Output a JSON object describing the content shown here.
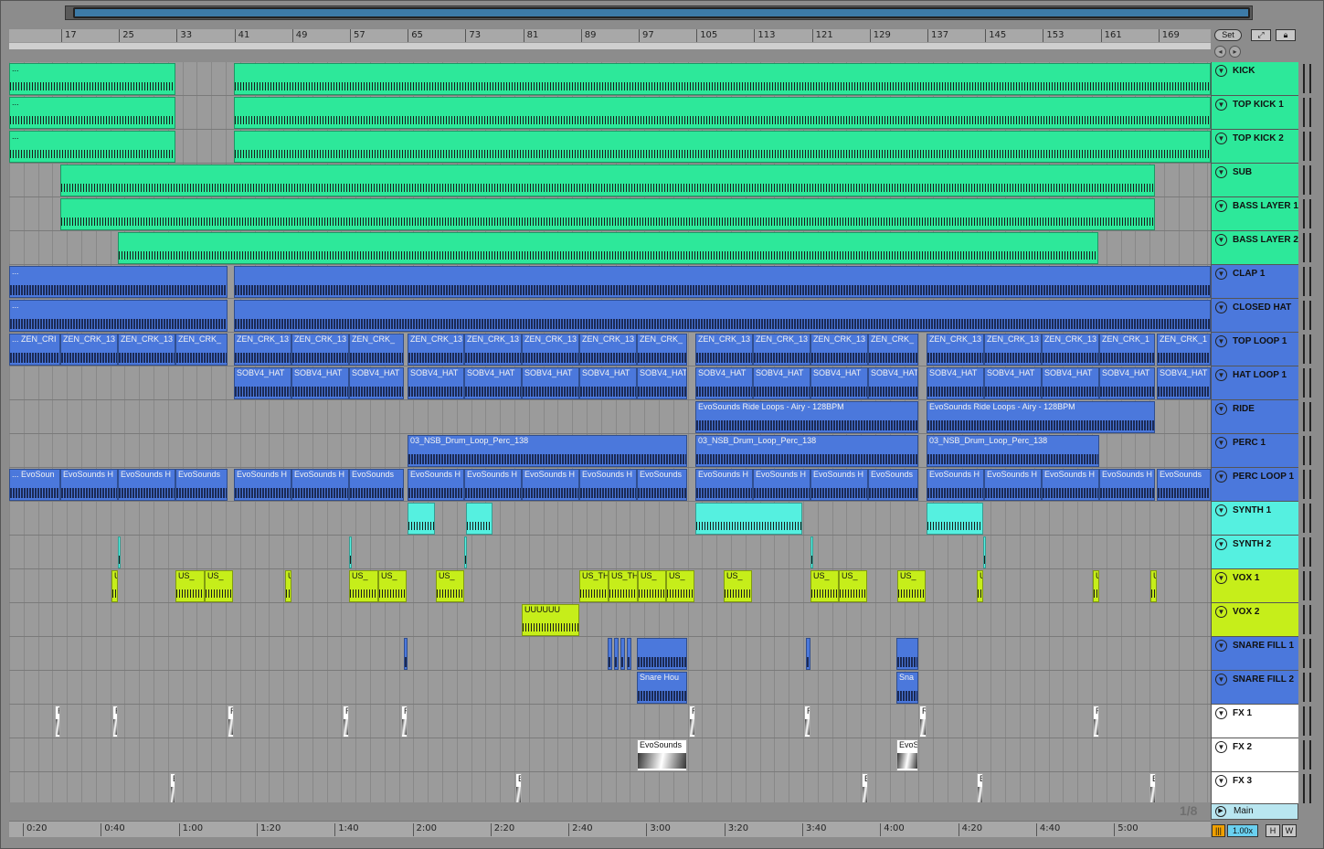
{
  "bars": [
    "17",
    "25",
    "33",
    "41",
    "49",
    "57",
    "65",
    "73",
    "81",
    "89",
    "97",
    "105",
    "113",
    "121",
    "129",
    "137",
    "145",
    "153",
    "161",
    "169"
  ],
  "times": [
    "0:20",
    "0:40",
    "1:00",
    "1:20",
    "1:40",
    "2:00",
    "2:20",
    "2:40",
    "3:00",
    "3:20",
    "3:40",
    "4:00",
    "4:20",
    "4:40",
    "5:00"
  ],
  "grid_quant": "1/8",
  "controls": {
    "set_label": "Set",
    "follow_icon": "follow-icon",
    "lock_icon": "lock-icon",
    "zoom": "1.00x",
    "h_label": "H",
    "w_label": "W"
  },
  "main_track": {
    "label": "Main"
  },
  "colors": {
    "green": "#2de89a",
    "blue": "#4b78dc",
    "cyan": "#55f0e0",
    "lime": "#c6ee1a",
    "white": "#ffffff"
  },
  "tracks": [
    {
      "name": "KICK",
      "color": "#2de89a"
    },
    {
      "name": "TOP KICK 1",
      "color": "#2de89a"
    },
    {
      "name": "TOP KICK 2",
      "color": "#2de89a"
    },
    {
      "name": "SUB",
      "color": "#2de89a"
    },
    {
      "name": "BASS LAYER 1",
      "color": "#2de89a"
    },
    {
      "name": "BASS LAYER 2",
      "color": "#2de89a"
    },
    {
      "name": "CLAP 1",
      "color": "#4b78dc"
    },
    {
      "name": "CLOSED HAT",
      "color": "#4b78dc"
    },
    {
      "name": "TOP LOOP 1",
      "color": "#4b78dc"
    },
    {
      "name": "HAT LOOP 1",
      "color": "#4b78dc"
    },
    {
      "name": "RIDE",
      "color": "#4b78dc"
    },
    {
      "name": "PERC 1",
      "color": "#4b78dc"
    },
    {
      "name": "PERC LOOP 1",
      "color": "#4b78dc"
    },
    {
      "name": "SYNTH 1",
      "color": "#55f0e0"
    },
    {
      "name": "SYNTH 2",
      "color": "#55f0e0"
    },
    {
      "name": "VOX 1",
      "color": "#c6ee1a"
    },
    {
      "name": "VOX 2",
      "color": "#c6ee1a"
    },
    {
      "name": "SNARE FILL 1",
      "color": "#4b78dc"
    },
    {
      "name": "SNARE FILL 2",
      "color": "#4b78dc"
    },
    {
      "name": "FX 1",
      "color": "#ffffff"
    },
    {
      "name": "FX 2",
      "color": "#ffffff"
    },
    {
      "name": "FX 3",
      "color": "#ffffff"
    }
  ],
  "clips": [
    {
      "track": 0,
      "start": 0,
      "end": 182,
      "label": "...",
      "color": "#2de89a"
    },
    {
      "track": 0,
      "start": 246,
      "end": 1315,
      "label": "",
      "color": "#2de89a"
    },
    {
      "track": 1,
      "start": 0,
      "end": 182,
      "label": "...",
      "color": "#2de89a"
    },
    {
      "track": 1,
      "start": 246,
      "end": 1315,
      "label": "",
      "color": "#2de89a"
    },
    {
      "track": 2,
      "start": 0,
      "end": 182,
      "label": "...",
      "color": "#2de89a"
    },
    {
      "track": 2,
      "start": 246,
      "end": 1315,
      "label": "",
      "color": "#2de89a"
    },
    {
      "track": 3,
      "start": 56,
      "end": 1254,
      "label": "",
      "color": "#2de89a"
    },
    {
      "track": 4,
      "start": 56,
      "end": 1254,
      "label": "",
      "color": "#2de89a"
    },
    {
      "track": 5,
      "start": 119,
      "end": 1192,
      "label": "",
      "color": "#2de89a"
    },
    {
      "track": 6,
      "start": 0,
      "end": 239,
      "label": "...",
      "color": "#4b78dc"
    },
    {
      "track": 6,
      "start": 246,
      "end": 1315,
      "label": "",
      "color": "#4b78dc"
    },
    {
      "track": 7,
      "start": 0,
      "end": 239,
      "label": "...",
      "color": "#4b78dc"
    },
    {
      "track": 7,
      "start": 246,
      "end": 1315,
      "label": "",
      "color": "#4b78dc"
    },
    {
      "track": 8,
      "start": 0,
      "end": 56,
      "label": "... ZEN_CRI",
      "color": "#4b78dc"
    },
    {
      "track": 8,
      "start": 56,
      "end": 119,
      "label": "ZEN_CRK_13",
      "color": "#4b78dc"
    },
    {
      "track": 8,
      "start": 119,
      "end": 182,
      "label": "ZEN_CRK_13",
      "color": "#4b78dc"
    },
    {
      "track": 8,
      "start": 182,
      "end": 239,
      "label": "ZEN_CRK_",
      "color": "#4b78dc"
    },
    {
      "track": 8,
      "start": 246,
      "end": 309,
      "label": "ZEN_CRK_13",
      "color": "#4b78dc"
    },
    {
      "track": 8,
      "start": 309,
      "end": 372,
      "label": "ZEN_CRK_13",
      "color": "#4b78dc"
    },
    {
      "track": 8,
      "start": 372,
      "end": 432,
      "label": "ZEN_CRK_",
      "color": "#4b78dc"
    },
    {
      "track": 8,
      "start": 436,
      "end": 498,
      "label": "ZEN_CRK_13",
      "color": "#4b78dc"
    },
    {
      "track": 8,
      "start": 498,
      "end": 561,
      "label": "ZEN_CRK_13",
      "color": "#4b78dc"
    },
    {
      "track": 8,
      "start": 561,
      "end": 624,
      "label": "ZEN_CRK_13",
      "color": "#4b78dc"
    },
    {
      "track": 8,
      "start": 624,
      "end": 687,
      "label": "ZEN_CRK_13",
      "color": "#4b78dc"
    },
    {
      "track": 8,
      "start": 687,
      "end": 742,
      "label": "ZEN_CRK_",
      "color": "#4b78dc"
    },
    {
      "track": 8,
      "start": 751,
      "end": 814,
      "label": "ZEN_CRK_13",
      "color": "#4b78dc"
    },
    {
      "track": 8,
      "start": 814,
      "end": 877,
      "label": "ZEN_CRK_13",
      "color": "#4b78dc"
    },
    {
      "track": 8,
      "start": 877,
      "end": 940,
      "label": "ZEN_CRK_13",
      "color": "#4b78dc"
    },
    {
      "track": 8,
      "start": 940,
      "end": 995,
      "label": "ZEN_CRK_",
      "color": "#4b78dc"
    },
    {
      "track": 8,
      "start": 1004,
      "end": 1067,
      "label": "ZEN_CRK_13",
      "color": "#4b78dc"
    },
    {
      "track": 8,
      "start": 1067,
      "end": 1130,
      "label": "ZEN_CRK_13",
      "color": "#4b78dc"
    },
    {
      "track": 8,
      "start": 1130,
      "end": 1193,
      "label": "ZEN_CRK_13",
      "color": "#4b78dc"
    },
    {
      "track": 8,
      "start": 1193,
      "end": 1254,
      "label": "ZEN_CRK_1",
      "color": "#4b78dc"
    },
    {
      "track": 8,
      "start": 1256,
      "end": 1315,
      "label": "ZEN_CRK_1",
      "color": "#4b78dc"
    },
    {
      "track": 9,
      "start": 246,
      "end": 309,
      "label": "SOBV4_HAT",
      "color": "#4b78dc"
    },
    {
      "track": 9,
      "start": 309,
      "end": 372,
      "label": "SOBV4_HAT",
      "color": "#4b78dc"
    },
    {
      "track": 9,
      "start": 372,
      "end": 432,
      "label": "SOBV4_HAT",
      "color": "#4b78dc"
    },
    {
      "track": 9,
      "start": 436,
      "end": 498,
      "label": "SOBV4_HAT",
      "color": "#4b78dc"
    },
    {
      "track": 9,
      "start": 498,
      "end": 561,
      "label": "SOBV4_HAT",
      "color": "#4b78dc"
    },
    {
      "track": 9,
      "start": 561,
      "end": 624,
      "label": "SOBV4_HAT",
      "color": "#4b78dc"
    },
    {
      "track": 9,
      "start": 624,
      "end": 687,
      "label": "SOBV4_HAT",
      "color": "#4b78dc"
    },
    {
      "track": 9,
      "start": 687,
      "end": 742,
      "label": "SOBV4_HAT",
      "color": "#4b78dc"
    },
    {
      "track": 9,
      "start": 751,
      "end": 814,
      "label": "SOBV4_HAT",
      "color": "#4b78dc"
    },
    {
      "track": 9,
      "start": 814,
      "end": 877,
      "label": "SOBV4_HAT",
      "color": "#4b78dc"
    },
    {
      "track": 9,
      "start": 877,
      "end": 940,
      "label": "SOBV4_HAT",
      "color": "#4b78dc"
    },
    {
      "track": 9,
      "start": 940,
      "end": 995,
      "label": "SOBV4_HAT",
      "color": "#4b78dc"
    },
    {
      "track": 9,
      "start": 1004,
      "end": 1067,
      "label": "SOBV4_HAT",
      "color": "#4b78dc"
    },
    {
      "track": 9,
      "start": 1067,
      "end": 1130,
      "label": "SOBV4_HAT",
      "color": "#4b78dc"
    },
    {
      "track": 9,
      "start": 1130,
      "end": 1193,
      "label": "SOBV4_HAT",
      "color": "#4b78dc"
    },
    {
      "track": 9,
      "start": 1193,
      "end": 1254,
      "label": "SOBV4_HAT",
      "color": "#4b78dc"
    },
    {
      "track": 9,
      "start": 1256,
      "end": 1315,
      "label": "SOBV4_HAT",
      "color": "#4b78dc"
    },
    {
      "track": 10,
      "start": 751,
      "end": 995,
      "label": "EvoSounds Ride Loops - Airy - 128BPM",
      "color": "#4b78dc"
    },
    {
      "track": 10,
      "start": 1004,
      "end": 1254,
      "label": "EvoSounds Ride Loops - Airy - 128BPM",
      "color": "#4b78dc"
    },
    {
      "track": 11,
      "start": 436,
      "end": 742,
      "label": "03_NSB_Drum_Loop_Perc_138",
      "color": "#4b78dc"
    },
    {
      "track": 11,
      "start": 751,
      "end": 995,
      "label": "03_NSB_Drum_Loop_Perc_138",
      "color": "#4b78dc"
    },
    {
      "track": 11,
      "start": 1004,
      "end": 1193,
      "label": "03_NSB_Drum_Loop_Perc_138",
      "color": "#4b78dc"
    },
    {
      "track": 12,
      "start": 0,
      "end": 56,
      "label": "... EvoSoun",
      "color": "#4b78dc"
    },
    {
      "track": 12,
      "start": 56,
      "end": 119,
      "label": "EvoSounds H",
      "color": "#4b78dc"
    },
    {
      "track": 12,
      "start": 119,
      "end": 182,
      "label": "EvoSounds H",
      "color": "#4b78dc"
    },
    {
      "track": 12,
      "start": 182,
      "end": 239,
      "label": "EvoSounds",
      "color": "#4b78dc"
    },
    {
      "track": 12,
      "start": 246,
      "end": 309,
      "label": "EvoSounds H",
      "color": "#4b78dc"
    },
    {
      "track": 12,
      "start": 309,
      "end": 372,
      "label": "EvoSounds H",
      "color": "#4b78dc"
    },
    {
      "track": 12,
      "start": 372,
      "end": 432,
      "label": "EvoSounds",
      "color": "#4b78dc"
    },
    {
      "track": 12,
      "start": 436,
      "end": 498,
      "label": "EvoSounds H",
      "color": "#4b78dc"
    },
    {
      "track": 12,
      "start": 498,
      "end": 561,
      "label": "EvoSounds H",
      "color": "#4b78dc"
    },
    {
      "track": 12,
      "start": 561,
      "end": 624,
      "label": "EvoSounds H",
      "color": "#4b78dc"
    },
    {
      "track": 12,
      "start": 624,
      "end": 687,
      "label": "EvoSounds H",
      "color": "#4b78dc"
    },
    {
      "track": 12,
      "start": 687,
      "end": 742,
      "label": "EvoSounds",
      "color": "#4b78dc"
    },
    {
      "track": 12,
      "start": 751,
      "end": 814,
      "label": "EvoSounds H",
      "color": "#4b78dc"
    },
    {
      "track": 12,
      "start": 814,
      "end": 877,
      "label": "EvoSounds H",
      "color": "#4b78dc"
    },
    {
      "track": 12,
      "start": 877,
      "end": 940,
      "label": "EvoSounds H",
      "color": "#4b78dc"
    },
    {
      "track": 12,
      "start": 940,
      "end": 995,
      "label": "EvoSounds",
      "color": "#4b78dc"
    },
    {
      "track": 12,
      "start": 1004,
      "end": 1067,
      "label": "EvoSounds H",
      "color": "#4b78dc"
    },
    {
      "track": 12,
      "start": 1067,
      "end": 1130,
      "label": "EvoSounds H",
      "color": "#4b78dc"
    },
    {
      "track": 12,
      "start": 1130,
      "end": 1193,
      "label": "EvoSounds H",
      "color": "#4b78dc"
    },
    {
      "track": 12,
      "start": 1193,
      "end": 1254,
      "label": "EvoSounds H",
      "color": "#4b78dc"
    },
    {
      "track": 12,
      "start": 1256,
      "end": 1315,
      "label": "EvoSounds",
      "color": "#4b78dc"
    },
    {
      "track": 13,
      "start": 436,
      "end": 466,
      "label": "",
      "color": "#55f0e0"
    },
    {
      "track": 13,
      "start": 500,
      "end": 529,
      "label": "",
      "color": "#55f0e0"
    },
    {
      "track": 13,
      "start": 751,
      "end": 868,
      "label": "",
      "color": "#55f0e0"
    },
    {
      "track": 13,
      "start": 1004,
      "end": 1066,
      "label": "",
      "color": "#55f0e0"
    },
    {
      "track": 14,
      "start": 119,
      "end": 122,
      "label": "",
      "color": "#55f0e0"
    },
    {
      "track": 14,
      "start": 372,
      "end": 375,
      "label": "",
      "color": "#55f0e0"
    },
    {
      "track": 14,
      "start": 498,
      "end": 501,
      "label": "",
      "color": "#55f0e0"
    },
    {
      "track": 14,
      "start": 877,
      "end": 880,
      "label": "",
      "color": "#55f0e0"
    },
    {
      "track": 14,
      "start": 1066,
      "end": 1069,
      "label": "",
      "color": "#55f0e0"
    },
    {
      "track": 15,
      "start": 112,
      "end": 119,
      "label": "U",
      "color": "#c6ee1a"
    },
    {
      "track": 15,
      "start": 182,
      "end": 214,
      "label": "US_",
      "color": "#c6ee1a"
    },
    {
      "track": 15,
      "start": 214,
      "end": 245,
      "label": "US_",
      "color": "#c6ee1a"
    },
    {
      "track": 15,
      "start": 302,
      "end": 309,
      "label": "U",
      "color": "#c6ee1a"
    },
    {
      "track": 15,
      "start": 372,
      "end": 404,
      "label": "US_",
      "color": "#c6ee1a"
    },
    {
      "track": 15,
      "start": 404,
      "end": 435,
      "label": "US_",
      "color": "#c6ee1a"
    },
    {
      "track": 15,
      "start": 467,
      "end": 498,
      "label": "US_",
      "color": "#c6ee1a"
    },
    {
      "track": 15,
      "start": 624,
      "end": 656,
      "label": "US_TH",
      "color": "#c6ee1a"
    },
    {
      "track": 15,
      "start": 656,
      "end": 688,
      "label": "US_TH",
      "color": "#c6ee1a"
    },
    {
      "track": 15,
      "start": 688,
      "end": 719,
      "label": "US_",
      "color": "#c6ee1a"
    },
    {
      "track": 15,
      "start": 719,
      "end": 750,
      "label": "US_",
      "color": "#c6ee1a"
    },
    {
      "track": 15,
      "start": 782,
      "end": 813,
      "label": "US_",
      "color": "#c6ee1a"
    },
    {
      "track": 15,
      "start": 877,
      "end": 908,
      "label": "US_",
      "color": "#c6ee1a"
    },
    {
      "track": 15,
      "start": 908,
      "end": 939,
      "label": "US_",
      "color": "#c6ee1a"
    },
    {
      "track": 15,
      "start": 972,
      "end": 1003,
      "label": "US_",
      "color": "#c6ee1a"
    },
    {
      "track": 15,
      "start": 1059,
      "end": 1066,
      "label": "U",
      "color": "#c6ee1a"
    },
    {
      "track": 15,
      "start": 1186,
      "end": 1193,
      "label": "U",
      "color": "#c6ee1a"
    },
    {
      "track": 15,
      "start": 1249,
      "end": 1256,
      "label": "U",
      "color": "#c6ee1a"
    },
    {
      "track": 16,
      "start": 561,
      "end": 624,
      "label": "UUUUUU",
      "color": "#c6ee1a"
    },
    {
      "track": 17,
      "start": 432,
      "end": 436,
      "label": "",
      "color": "#4b78dc"
    },
    {
      "track": 17,
      "start": 655,
      "end": 660,
      "label": "",
      "color": "#4b78dc"
    },
    {
      "track": 17,
      "start": 662,
      "end": 667,
      "label": "",
      "color": "#4b78dc"
    },
    {
      "track": 17,
      "start": 669,
      "end": 674,
      "label": "",
      "color": "#4b78dc"
    },
    {
      "track": 17,
      "start": 676,
      "end": 681,
      "label": "",
      "color": "#4b78dc"
    },
    {
      "track": 17,
      "start": 687,
      "end": 742,
      "label": "",
      "color": "#4b78dc"
    },
    {
      "track": 17,
      "start": 872,
      "end": 877,
      "label": "",
      "color": "#4b78dc"
    },
    {
      "track": 17,
      "start": 971,
      "end": 995,
      "label": "",
      "color": "#4b78dc"
    },
    {
      "track": 18,
      "start": 687,
      "end": 742,
      "label": "Snare Hou",
      "color": "#4b78dc"
    },
    {
      "track": 18,
      "start": 971,
      "end": 995,
      "label": "Sna",
      "color": "#4b78dc"
    },
    {
      "track": 19,
      "start": 50,
      "end": 56,
      "label": "R",
      "color": "#ffffff"
    },
    {
      "track": 19,
      "start": 113,
      "end": 119,
      "label": "R",
      "color": "#ffffff"
    },
    {
      "track": 19,
      "start": 239,
      "end": 246,
      "label": "R",
      "color": "#ffffff"
    },
    {
      "track": 19,
      "start": 365,
      "end": 372,
      "label": "R",
      "color": "#ffffff"
    },
    {
      "track": 19,
      "start": 429,
      "end": 436,
      "label": "R",
      "color": "#ffffff"
    },
    {
      "track": 19,
      "start": 744,
      "end": 751,
      "label": "R",
      "color": "#ffffff"
    },
    {
      "track": 19,
      "start": 870,
      "end": 877,
      "label": "R",
      "color": "#ffffff"
    },
    {
      "track": 19,
      "start": 996,
      "end": 1004,
      "label": "R",
      "color": "#ffffff"
    },
    {
      "track": 19,
      "start": 1186,
      "end": 1193,
      "label": "R",
      "color": "#ffffff"
    },
    {
      "track": 20,
      "start": 687,
      "end": 742,
      "label": "EvoSounds",
      "color": "#ffffff"
    },
    {
      "track": 20,
      "start": 971,
      "end": 995,
      "label": "EvoS",
      "color": "#ffffff"
    },
    {
      "track": 21,
      "start": 176,
      "end": 182,
      "label": "E",
      "color": "#ffffff"
    },
    {
      "track": 21,
      "start": 554,
      "end": 561,
      "label": "E",
      "color": "#ffffff"
    },
    {
      "track": 21,
      "start": 933,
      "end": 940,
      "label": "E",
      "color": "#ffffff"
    },
    {
      "track": 21,
      "start": 1059,
      "end": 1066,
      "label": "E",
      "color": "#ffffff"
    },
    {
      "track": 21,
      "start": 1248,
      "end": 1255,
      "label": "E",
      "color": "#ffffff"
    }
  ]
}
